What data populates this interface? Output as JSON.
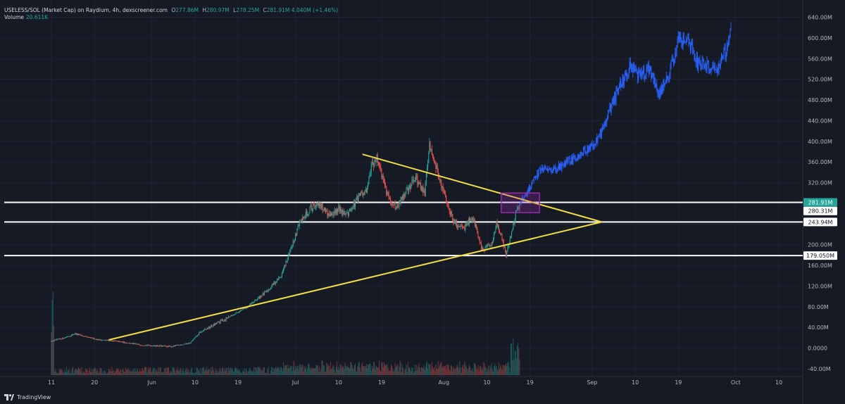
{
  "header": {
    "symbol": "USELESS/SOL (Market Cap) on Raydium, 4h, dexscreener.com",
    "open_label": "O",
    "open": "277.86M",
    "high_label": "H",
    "high": "280.97M",
    "low_label": "L",
    "low": "278.25M",
    "close_label": "C",
    "close": "281.91M",
    "change": "4.040M (+1.46%)",
    "volume_label": "Volume",
    "volume": "20.611K"
  },
  "brand": {
    "name": "TradingView"
  },
  "colors": {
    "background": "#161a25",
    "grid": "#1f2330",
    "axis_text": "#b2b5be",
    "up": "#26a69a",
    "down": "#ef5350",
    "projection": "#2962ff",
    "triangle": "#f0dc44",
    "levels": "#ffffff",
    "box": "#9c27b0"
  },
  "chart_data": {
    "type": "candlestick",
    "title": "",
    "y_unit": "M",
    "ylim": [
      -50,
      650
    ],
    "y_ticks": [
      "640.00M",
      "600.00M",
      "560.00M",
      "520.00M",
      "480.00M",
      "440.00M",
      "400.00M",
      "360.00M",
      "320.00M",
      "280.00M",
      "240.00M",
      "200.00M",
      "160.00M",
      "120.00M",
      "80.00M",
      "40.00M",
      "0.0000",
      "-40.00M"
    ],
    "x_ticks": [
      "11",
      "20",
      "Jun",
      "10",
      "19",
      "Jul",
      "10",
      "19",
      "Aug",
      "10",
      "19",
      "Sep",
      "10",
      "19",
      "Oct",
      "10"
    ],
    "x_tick_days": [
      11,
      20,
      32,
      41,
      50,
      62,
      71,
      80,
      93,
      102,
      111,
      124,
      133,
      142,
      154,
      163
    ],
    "x_range_days": [
      11,
      171
    ],
    "price_labels": [
      {
        "text": "281.91M",
        "value": 281.91,
        "style": "current"
      },
      {
        "text": "280.31M",
        "value": 280.31,
        "style": "level"
      },
      {
        "text": "243.94M",
        "value": 243.94,
        "style": "level"
      },
      {
        "text": "179.050M",
        "value": 179.05,
        "style": "level"
      }
    ],
    "horizontal_levels": [
      281.91,
      243.94,
      179.05
    ],
    "history_keypoints": [
      {
        "d": 11,
        "v": 14
      },
      {
        "d": 13,
        "v": 18
      },
      {
        "d": 16,
        "v": 28
      },
      {
        "d": 18,
        "v": 22
      },
      {
        "d": 21,
        "v": 16
      },
      {
        "d": 24,
        "v": 14
      },
      {
        "d": 30,
        "v": 6
      },
      {
        "d": 36,
        "v": 3
      },
      {
        "d": 40,
        "v": 10
      },
      {
        "d": 42,
        "v": 30
      },
      {
        "d": 47,
        "v": 55
      },
      {
        "d": 52,
        "v": 80
      },
      {
        "d": 56,
        "v": 110
      },
      {
        "d": 59,
        "v": 140
      },
      {
        "d": 61,
        "v": 190
      },
      {
        "d": 63,
        "v": 245
      },
      {
        "d": 65,
        "v": 270
      },
      {
        "d": 67,
        "v": 280
      },
      {
        "d": 69,
        "v": 255
      },
      {
        "d": 71,
        "v": 270
      },
      {
        "d": 73,
        "v": 260
      },
      {
        "d": 75,
        "v": 290
      },
      {
        "d": 77,
        "v": 310
      },
      {
        "d": 78,
        "v": 355
      },
      {
        "d": 79,
        "v": 370
      },
      {
        "d": 81,
        "v": 300
      },
      {
        "d": 83,
        "v": 270
      },
      {
        "d": 85,
        "v": 300
      },
      {
        "d": 87,
        "v": 330
      },
      {
        "d": 89,
        "v": 300
      },
      {
        "d": 90,
        "v": 395
      },
      {
        "d": 91,
        "v": 360
      },
      {
        "d": 93,
        "v": 300
      },
      {
        "d": 95,
        "v": 245
      },
      {
        "d": 97,
        "v": 230
      },
      {
        "d": 99,
        "v": 255
      },
      {
        "d": 101,
        "v": 190
      },
      {
        "d": 103,
        "v": 200
      },
      {
        "d": 104,
        "v": 240
      },
      {
        "d": 105,
        "v": 220
      },
      {
        "d": 106,
        "v": 180
      },
      {
        "d": 107,
        "v": 215
      },
      {
        "d": 108,
        "v": 260
      },
      {
        "d": 109,
        "v": 282
      }
    ],
    "projection_keypoints": [
      {
        "d": 109,
        "v": 282
      },
      {
        "d": 111,
        "v": 310
      },
      {
        "d": 113,
        "v": 345
      },
      {
        "d": 116,
        "v": 345
      },
      {
        "d": 118,
        "v": 355
      },
      {
        "d": 120,
        "v": 365
      },
      {
        "d": 122,
        "v": 380
      },
      {
        "d": 124,
        "v": 390
      },
      {
        "d": 126,
        "v": 420
      },
      {
        "d": 128,
        "v": 470
      },
      {
        "d": 130,
        "v": 510
      },
      {
        "d": 132,
        "v": 545
      },
      {
        "d": 134,
        "v": 525
      },
      {
        "d": 136,
        "v": 540
      },
      {
        "d": 138,
        "v": 490
      },
      {
        "d": 140,
        "v": 530
      },
      {
        "d": 142,
        "v": 595
      },
      {
        "d": 144,
        "v": 600
      },
      {
        "d": 146,
        "v": 550
      },
      {
        "d": 148,
        "v": 545
      },
      {
        "d": 150,
        "v": 540
      },
      {
        "d": 152,
        "v": 575
      },
      {
        "d": 153,
        "v": 615
      }
    ],
    "triangle": {
      "upper": [
        {
          "d": 76,
          "v": 375
        },
        {
          "d": 126,
          "v": 244
        }
      ],
      "lower": [
        {
          "d": 23,
          "v": 16
        },
        {
          "d": 126,
          "v": 244
        }
      ]
    },
    "box": {
      "d0": 105,
      "d1": 113,
      "v0": 262,
      "v1": 300
    }
  }
}
